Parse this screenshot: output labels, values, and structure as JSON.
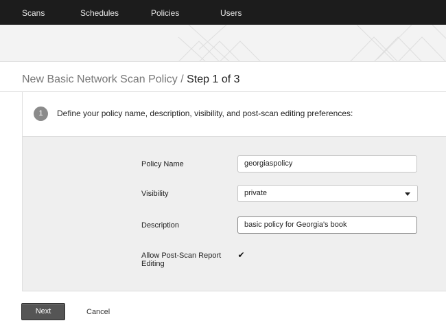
{
  "nav": {
    "items": [
      {
        "label": "Scans"
      },
      {
        "label": "Schedules"
      },
      {
        "label": "Policies"
      },
      {
        "label": "Users"
      }
    ]
  },
  "page": {
    "title_main": "New Basic Network Scan Policy",
    "title_sep": "/",
    "title_step": "Step 1 of 3"
  },
  "step": {
    "number": "1",
    "text": "Define your policy name, description, visibility, and post-scan editing preferences:"
  },
  "form": {
    "policy_name_label": "Policy Name",
    "policy_name_value": "georgiaspolicy",
    "visibility_label": "Visibility",
    "visibility_value": "private",
    "description_label": "Description",
    "description_value": "basic policy for Georgia's book",
    "allow_edit_label": "Allow Post-Scan Report Editing",
    "allow_edit_checked": true,
    "check_glyph": "✔"
  },
  "footer": {
    "next_label": "Next",
    "cancel_label": "Cancel"
  }
}
